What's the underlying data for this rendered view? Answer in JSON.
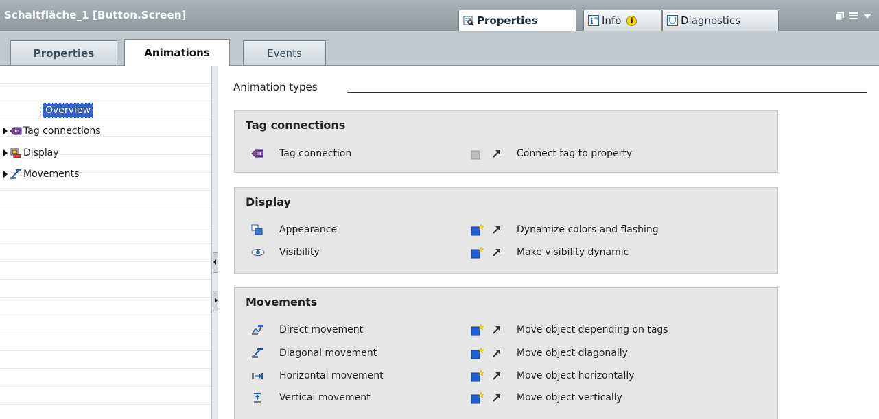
{
  "titlebar": {
    "title": "Schaltfläche_1 [Button.Screen]",
    "tabs": {
      "properties": "Properties",
      "info": "Info",
      "info_badge": "i",
      "diagnostics": "Diagnostics"
    }
  },
  "subtabs": {
    "properties": "Properties",
    "animations": "Animations",
    "events": "Events"
  },
  "tree": {
    "overview": "Overview",
    "items": [
      {
        "label": "Tag connections",
        "icon": "tag-connection-icon"
      },
      {
        "label": "Display",
        "icon": "display-icon"
      },
      {
        "label": "Movements",
        "icon": "movement-icon"
      }
    ]
  },
  "main": {
    "header": "Animation types",
    "groups": [
      {
        "title": "Tag connections",
        "rows": [
          {
            "label": "Tag connection",
            "desc": "Connect tag to property",
            "enabled": false
          }
        ]
      },
      {
        "title": "Display",
        "rows": [
          {
            "label": "Appearance",
            "desc": "Dynamize colors and flashing",
            "enabled": true
          },
          {
            "label": "Visibility",
            "desc": "Make visibility dynamic",
            "enabled": true
          }
        ]
      },
      {
        "title": "Movements",
        "rows": [
          {
            "label": "Direct movement",
            "desc": "Move object depending on tags",
            "enabled": true
          },
          {
            "label": "Diagonal movement",
            "desc": "Move object diagonally",
            "enabled": true
          },
          {
            "label": "Horizontal movement",
            "desc": "Move object horizontally",
            "enabled": true
          },
          {
            "label": "Vertical movement",
            "desc": "Move object vertically",
            "enabled": true
          }
        ]
      }
    ]
  },
  "colors": {
    "titlebar": "#9aa3a9",
    "selection": "#3561c3",
    "group_bg": "#e6e6e6",
    "new_icon_enabled": "#1f5fd6",
    "new_icon_disabled": "#bdbdbd"
  }
}
